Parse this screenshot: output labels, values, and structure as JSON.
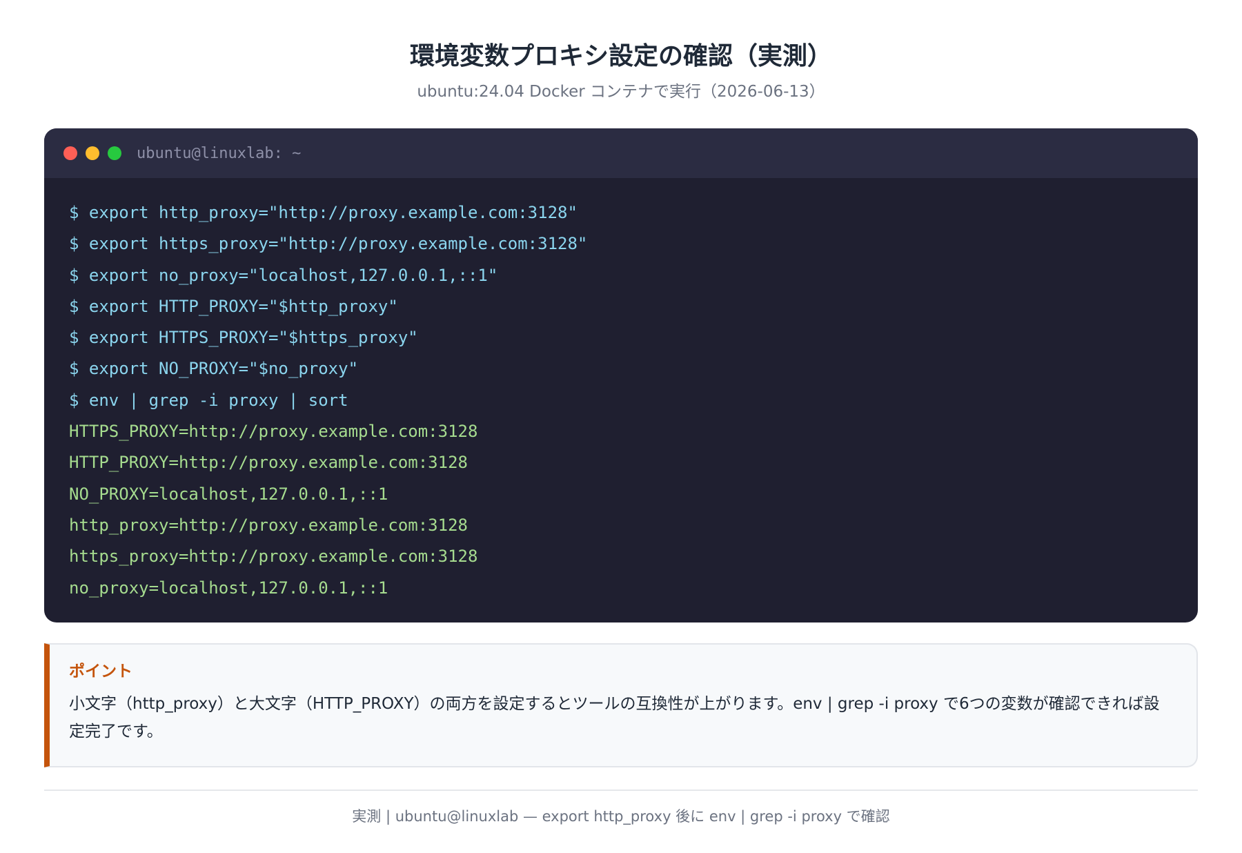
{
  "header": {
    "title": "環境変数プロキシ設定の確認（実測）",
    "subtitle": "ubuntu:24.04 Docker コンテナで実行（2026-06-13）"
  },
  "terminal": {
    "window_title": "ubuntu@linuxlab: ~",
    "dot_colors": [
      "#ff5f56",
      "#ffbd2e",
      "#27c93f"
    ],
    "lines": [
      {
        "kind": "cmd",
        "text": "$ export http_proxy=\"http://proxy.example.com:3128\""
      },
      {
        "kind": "cmd",
        "text": "$ export https_proxy=\"http://proxy.example.com:3128\""
      },
      {
        "kind": "cmd",
        "text": "$ export no_proxy=\"localhost,127.0.0.1,::1\""
      },
      {
        "kind": "cmd",
        "text": "$ export HTTP_PROXY=\"$http_proxy\""
      },
      {
        "kind": "cmd",
        "text": "$ export HTTPS_PROXY=\"$https_proxy\""
      },
      {
        "kind": "cmd",
        "text": "$ export NO_PROXY=\"$no_proxy\""
      },
      {
        "kind": "cmd",
        "text": "$ env | grep -i proxy | sort"
      },
      {
        "kind": "out",
        "text": "HTTPS_PROXY=http://proxy.example.com:3128"
      },
      {
        "kind": "out",
        "text": "HTTP_PROXY=http://proxy.example.com:3128"
      },
      {
        "kind": "out",
        "text": "NO_PROXY=localhost,127.0.0.1,::1"
      },
      {
        "kind": "out",
        "text": "http_proxy=http://proxy.example.com:3128"
      },
      {
        "kind": "out",
        "text": "https_proxy=http://proxy.example.com:3128"
      },
      {
        "kind": "out",
        "text": "no_proxy=localhost,127.0.0.1,::1"
      }
    ]
  },
  "callout": {
    "title": "ポイント",
    "text": "小文字（http_proxy）と大文字（HTTP_PROXY）の両方を設定するとツールの互換性が上がります。env | grep -i proxy で6つの変数が確認できれば設定完了です。"
  },
  "footer": {
    "text": "実測 | ubuntu@linuxlab — export http_proxy 後に env | grep -i proxy で確認"
  },
  "colors": {
    "accent": "#c4540c",
    "command": "#8bd5ee",
    "output": "#a6dc8f",
    "terminal_bg": "#1f1f30"
  }
}
